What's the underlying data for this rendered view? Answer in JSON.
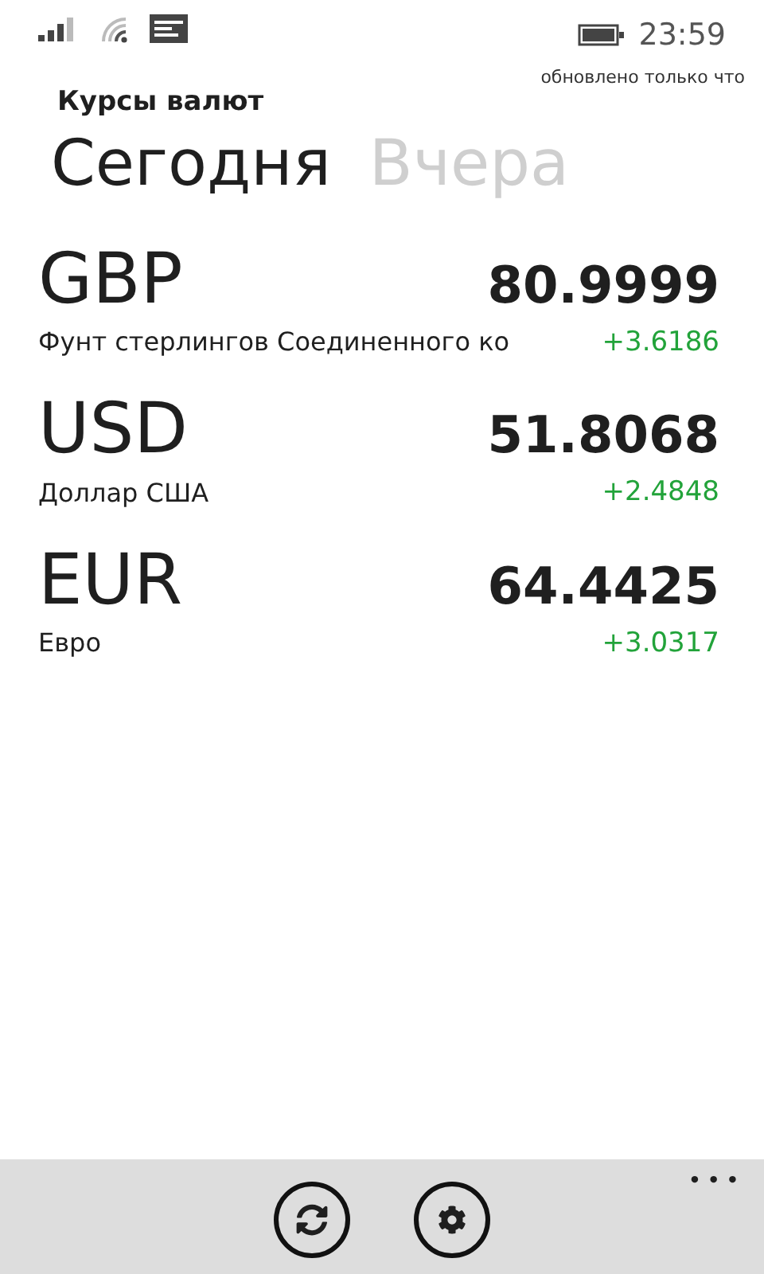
{
  "status_bar": {
    "time": "23:59",
    "note": "обновлено только что"
  },
  "app_title": "Курсы валют",
  "tabs": [
    {
      "label": "Сегодня",
      "selected": true
    },
    {
      "label": "Вчера",
      "selected": false
    }
  ],
  "rates": [
    {
      "code": "GBP",
      "name": "Фунт стерлингов Соединенного ко",
      "rate": "80.9999",
      "change": "+3.6186"
    },
    {
      "code": "USD",
      "name": "Доллар США",
      "rate": "51.8068",
      "change": "+2.4848"
    },
    {
      "code": "EUR",
      "name": "Евро",
      "rate": "64.4425",
      "change": "+3.0317"
    }
  ],
  "app_bar": {
    "more": "• • •"
  }
}
